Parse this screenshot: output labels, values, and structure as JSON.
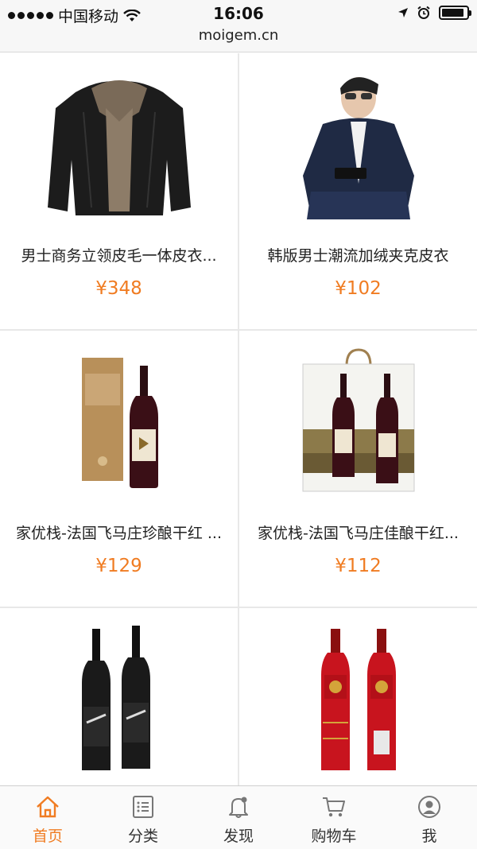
{
  "status_bar": {
    "carrier": "中国移动",
    "time": "16:06",
    "battery_level": 0.9
  },
  "url_bar": {
    "domain": "moigem.cn"
  },
  "products": [
    {
      "title": "男士商务立领皮毛一体皮衣...",
      "price": "¥348",
      "image": "black-fur-collar-leather-jacket"
    },
    {
      "title": "韩版男士潮流加绒夹克皮衣",
      "price": "¥102",
      "image": "man-in-navy-leather-jacket"
    },
    {
      "title": "家优栈-法国飞马庄珍酿干红 ...",
      "price": "¥129",
      "image": "wine-bottle-with-gold-box"
    },
    {
      "title": "家优栈-法国飞马庄佳酿干红...",
      "price": "¥112",
      "image": "wine-bottles-in-gift-bag"
    },
    {
      "title": "",
      "price": "",
      "image": "two-black-wine-bottles"
    },
    {
      "title": "",
      "price": "",
      "image": "two-red-wine-bottles"
    }
  ],
  "tab_bar": {
    "tabs": [
      {
        "label": "首页",
        "icon": "home-icon",
        "active": true
      },
      {
        "label": "分类",
        "icon": "list-icon",
        "active": false
      },
      {
        "label": "发现",
        "icon": "bell-icon",
        "active": false
      },
      {
        "label": "购物车",
        "icon": "cart-icon",
        "active": false
      },
      {
        "label": "我",
        "icon": "user-icon",
        "active": false
      }
    ]
  },
  "colors": {
    "accent": "#f07c22",
    "divider": "#e8e8e8"
  }
}
